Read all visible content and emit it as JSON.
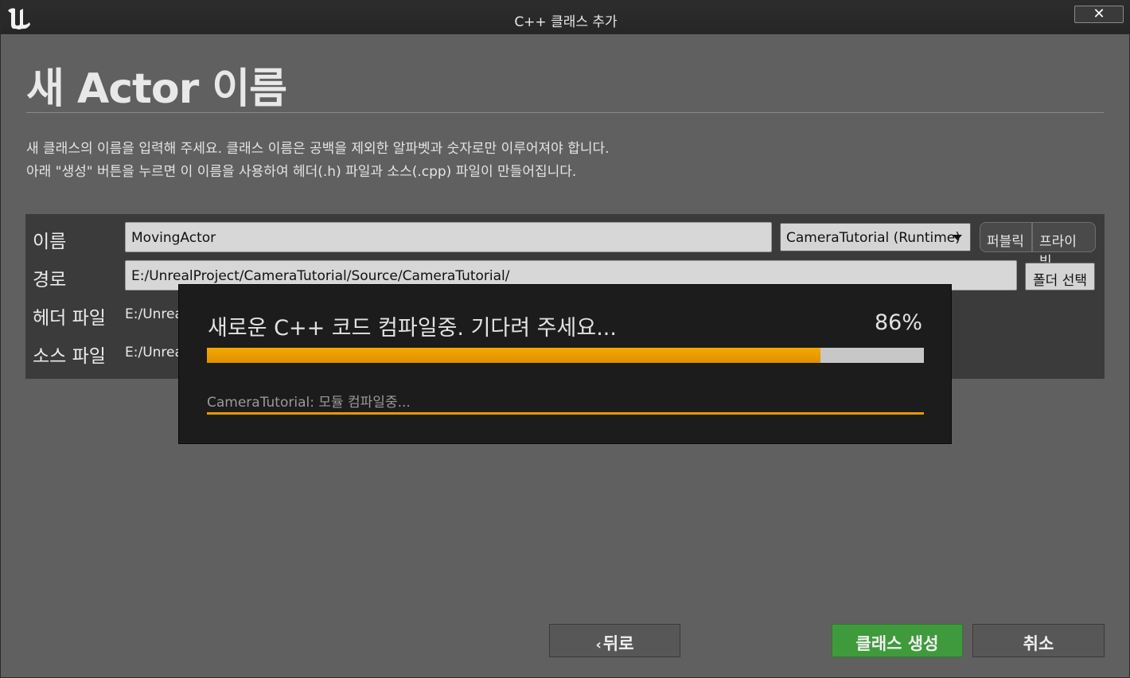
{
  "window": {
    "title": "C++ 클래스 추가",
    "close_label": "✕"
  },
  "header": {
    "title": "새 Actor 이름",
    "description_line1": "새 클래스의 이름을 입력해 주세요. 클래스 이름은 공백을 제외한 알파벳과 숫자로만 이루어져야 합니다.",
    "description_line2": "아래 \"생성\" 버튼을 누르면 이 이름을 사용하여 헤더(.h) 파일과 소스(.cpp) 파일이 만들어집니다."
  },
  "form": {
    "name_label": "이름",
    "name_value": "MovingActor",
    "module_value": "CameraTutorial (Runtime)",
    "visibility_public": "퍼블릭",
    "visibility_private": "프라이빗",
    "path_label": "경로",
    "path_value": "E:/UnrealProject/CameraTutorial/Source/CameraTutorial/",
    "folder_button": "폴더 선택",
    "header_label": "헤더 파일",
    "header_value": "E:/Unrea",
    "source_label": "소스 파일",
    "source_value": "E:/Unrea"
  },
  "progress": {
    "title": "새로운 C++ 코드 컴파일중. 기다려 주세요...",
    "percent_label": "86%",
    "fraction": 0.856,
    "status": "CameraTutorial: 모듈 컴파일중..."
  },
  "footer": {
    "back_arrow": "‹",
    "back_label": "뒤로",
    "create_label": "클래스 생성",
    "cancel_label": "취소"
  },
  "colors": {
    "progress_accent": "#f5a800",
    "create_button": "#3f9a3c",
    "panel_bg": "#3b3b3b",
    "window_bg": "#606060"
  },
  "icons": {
    "logo": "unreal-engine-logo",
    "close": "close-icon",
    "dropdown": "chevron-down-icon",
    "back": "back-arrow-icon"
  }
}
